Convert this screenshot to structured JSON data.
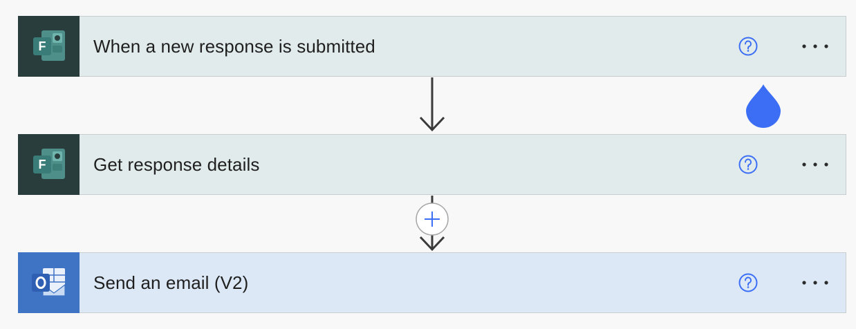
{
  "flow": {
    "steps": [
      {
        "title": "When a new response is submitted",
        "app": "Microsoft Forms",
        "icon": "forms-icon"
      },
      {
        "title": "Get response details",
        "app": "Microsoft Forms",
        "icon": "forms-icon"
      },
      {
        "title": "Send an email (V2)",
        "app": "Outlook",
        "icon": "outlook-icon"
      }
    ],
    "help_icon": "question-circle-icon",
    "more_icon": "ellipsis-icon",
    "insert_icon": "plus-icon",
    "colors": {
      "forms_card_bg": "#e1ebeb",
      "forms_icon_bg": "#2a3d3d",
      "outlook_card_bg": "#dce8f6",
      "outlook_icon_bg": "#3f73c4",
      "accent": "#3b6ef5"
    }
  }
}
